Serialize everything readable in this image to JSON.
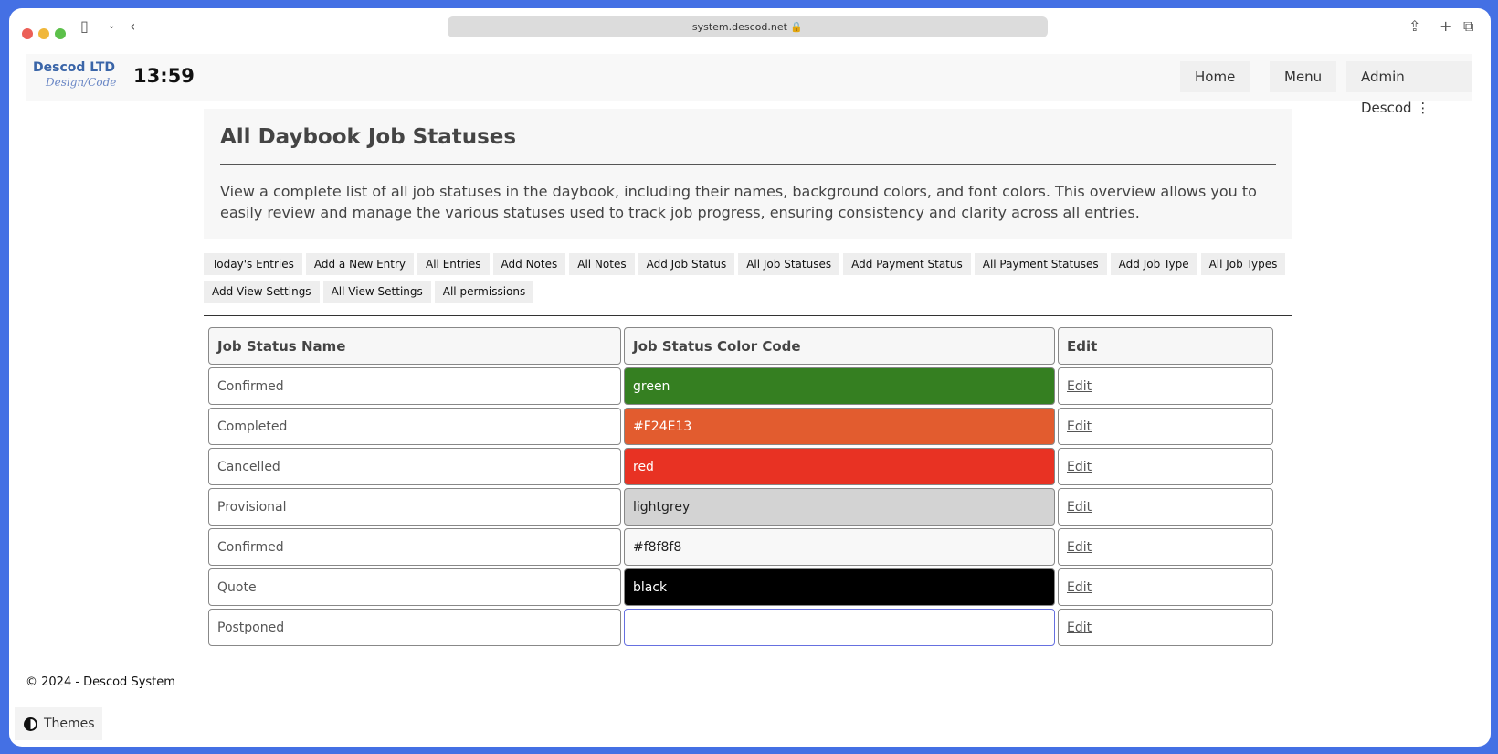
{
  "browser": {
    "url": "system.descod.net"
  },
  "header": {
    "logo_line1": "Descod LTD",
    "logo_line2": "Design/Code",
    "clock": "13:59",
    "nav": [
      "Home",
      "Menu",
      "Admin Descod"
    ]
  },
  "hero": {
    "title": "All Daybook Job Statuses",
    "description": "View a complete list of all job statuses in the daybook, including their names, background colors, and font colors. This overview allows you to easily review and manage the various statuses used to track job progress, ensuring consistency and clarity across all entries."
  },
  "links": [
    "Today's Entries",
    "Add a New Entry",
    "All Entries",
    "Add Notes",
    "All Notes",
    "Add Job Status",
    "All Job Statuses",
    "Add Payment Status",
    "All Payment Statuses",
    "Add Job Type",
    "All Job Types",
    "Add View Settings",
    "All View Settings",
    "All permissions"
  ],
  "table": {
    "headers": [
      "Job Status Name",
      "Job Status Color Code",
      "Edit"
    ],
    "rows": [
      {
        "name": "Confirmed",
        "code": "green",
        "bg": "#357f21",
        "fg": "#ffffff",
        "edit": "Edit"
      },
      {
        "name": "Completed",
        "code": "#F24E13",
        "bg": "#e25c2f",
        "fg": "#ffffff",
        "edit": "Edit"
      },
      {
        "name": "Cancelled",
        "code": "red",
        "bg": "#e83223",
        "fg": "#ffffff",
        "edit": "Edit"
      },
      {
        "name": "Provisional",
        "code": "lightgrey",
        "bg": "#d3d3d3",
        "fg": "#222222",
        "edit": "Edit"
      },
      {
        "name": "Confirmed",
        "code": "#f8f8f8",
        "bg": "#f8f8f8",
        "fg": "#222222",
        "edit": "Edit"
      },
      {
        "name": "Quote",
        "code": "black",
        "bg": "#000000",
        "fg": "#ffffff",
        "edit": "Edit"
      },
      {
        "name": "Postponed",
        "code": "",
        "bg": "#ffffff",
        "fg": "#222222",
        "edit": "Edit"
      }
    ]
  },
  "footer": {
    "copyright": "© 2024 - ",
    "link": "Descod System",
    "themes": "Themes"
  }
}
